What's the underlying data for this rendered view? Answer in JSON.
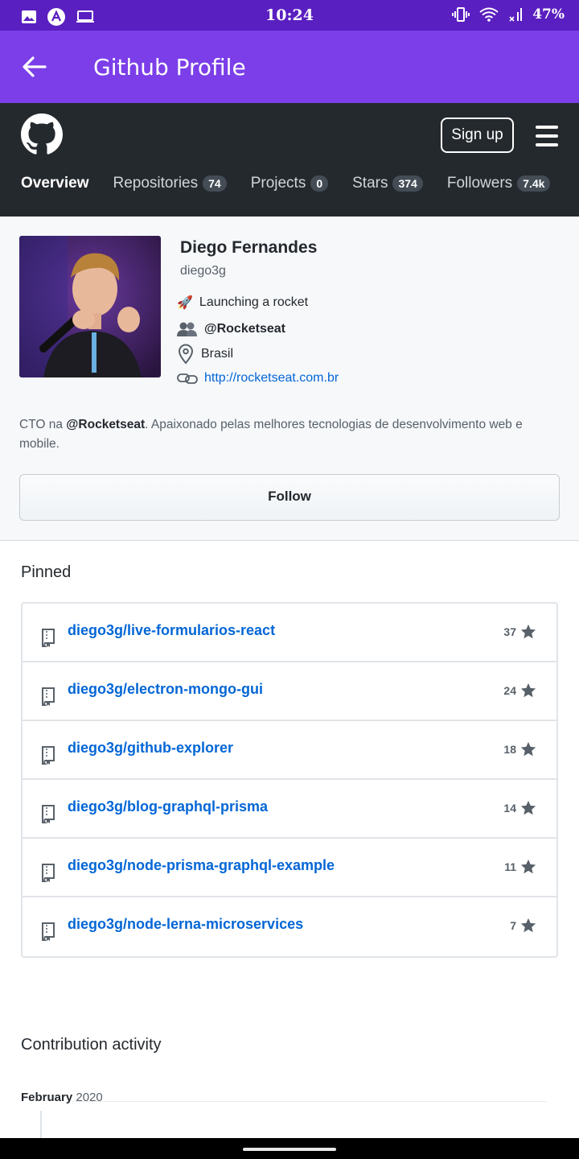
{
  "status_bar": {
    "time": "10:24",
    "battery": "47%"
  },
  "app_bar": {
    "title": "Github Profile"
  },
  "header": {
    "signup_label": "Sign up",
    "tabs": [
      {
        "label": "Overview",
        "count": null
      },
      {
        "label": "Repositories",
        "count": "74"
      },
      {
        "label": "Projects",
        "count": "0"
      },
      {
        "label": "Stars",
        "count": "374"
      },
      {
        "label": "Followers",
        "count": "7.4k"
      }
    ]
  },
  "profile": {
    "name": "Diego Fernandes",
    "login": "diego3g",
    "status_emoji": "🚀",
    "status": "Launching a rocket",
    "organization": "@Rocketseat",
    "location": "Brasil",
    "website": "http://rocketseat.com.br",
    "bio_prefix": "CTO na ",
    "bio_org": "@Rocketseat",
    "bio_rest": ". Apaixonado pelas melhores tecnologias de desenvolvimento web e mobile.",
    "follow_label": "Follow"
  },
  "pinned": {
    "title": "Pinned",
    "repos": [
      {
        "name": "diego3g/live-formularios-react",
        "stars": "37"
      },
      {
        "name": "diego3g/electron-mongo-gui",
        "stars": "24"
      },
      {
        "name": "diego3g/github-explorer",
        "stars": "18"
      },
      {
        "name": "diego3g/blog-graphql-prisma",
        "stars": "14"
      },
      {
        "name": "diego3g/node-prisma-graphql-example",
        "stars": "11"
      },
      {
        "name": "diego3g/node-lerna-microservices",
        "stars": "7"
      }
    ]
  },
  "contribution": {
    "title": "Contribution activity",
    "month": "February",
    "year": "2020"
  }
}
